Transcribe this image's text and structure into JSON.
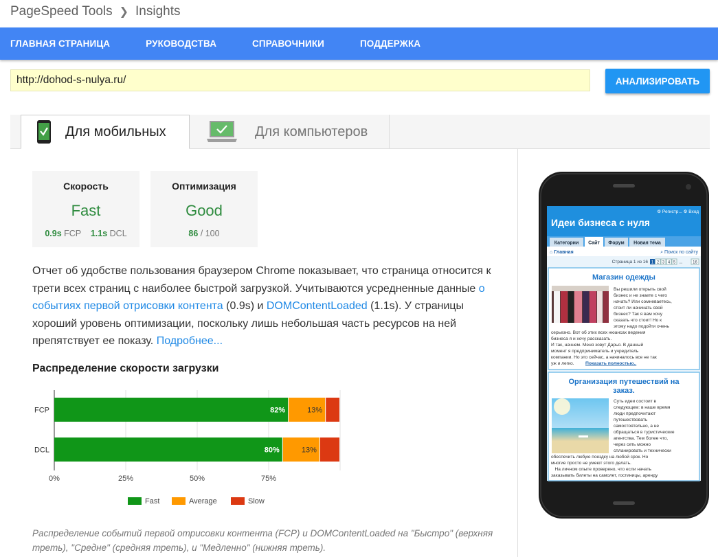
{
  "breadcrumb": {
    "root": "PageSpeed Tools",
    "current": "Insights"
  },
  "nav": {
    "items": [
      "ГЛАВНАЯ СТРАНИЦА",
      "РУКОВОДСТВА",
      "СПРАВОЧНИКИ",
      "ПОДДЕРЖКА"
    ]
  },
  "url_input": {
    "value": "http://dohod-s-nulya.ru/"
  },
  "analyze_button": "АНАЛИЗИРОВАТЬ",
  "tabs": [
    {
      "label": "Для мобильных",
      "icon": "mobile-check-icon",
      "active": true
    },
    {
      "label": "Для компьютеров",
      "icon": "desktop-check-icon",
      "active": false
    }
  ],
  "speed_card": {
    "title": "Скорость",
    "value": "Fast",
    "fcp_value": "0.9s",
    "fcp_label": "FCP",
    "dcl_value": "1.1s",
    "dcl_label": "DCL"
  },
  "optimization_card": {
    "title": "Оптимизация",
    "value": "Good",
    "score": "86",
    "max": "/ 100"
  },
  "report": {
    "text1": "Отчет об удобстве пользования браузером Chrome показывает, что страница относится к трети всех страниц с наиболее быстрой загрузкой. Учитываются усредненные данные ",
    "link1": "о событиях первой отрисовки контента",
    "text2": " (0.9s) и ",
    "link2": "DOMContentLoaded",
    "text3": " (1.1s). У страницы хороший уровень оптимизации, поскольку лишь небольшая часть ресурсов на ней препятствует ее показу. ",
    "link3": "Подробнее..."
  },
  "distribution_title": "Распределение скорости загрузки",
  "chart_data": {
    "type": "bar",
    "orientation": "horizontal",
    "stacked": true,
    "categories": [
      "FCP",
      "DCL"
    ],
    "series": [
      {
        "name": "Fast",
        "color": "#109618",
        "values": [
          82,
          80
        ]
      },
      {
        "name": "Average",
        "color": "#ff9900",
        "values": [
          13,
          13
        ]
      },
      {
        "name": "Slow",
        "color": "#dc3912",
        "values": [
          5,
          7
        ]
      }
    ],
    "data_labels": [
      [
        "82%",
        "13%",
        ""
      ],
      [
        "80%",
        "13%",
        ""
      ]
    ],
    "x_ticks": [
      "0%",
      "25%",
      "50%",
      "75%"
    ],
    "xlim": [
      0,
      100
    ],
    "grid": true,
    "legend_position": "bottom"
  },
  "footnote": "Распределение событий первой отрисовки контента (FCP) и DOMContentLoaded на \"Быстро\" (верхняя треть), \"Средне\" (средняя треть), и \"Медленно\" (нижняя треть).",
  "phone": {
    "top_links": [
      "Регистр...",
      "Вход"
    ],
    "site_title": "Идеи бизнеса с нуля",
    "tabs": [
      "Категории",
      "Сайт",
      "Форум",
      "Новая тема"
    ],
    "breadcrumb_home": "Главная",
    "search": "Поиск по сайту",
    "page_label": "Страница 1 из 16",
    "pages": [
      "1",
      "2",
      "3",
      "4",
      "5",
      "...",
      "16"
    ],
    "post1": {
      "title": "Магазин одежды",
      "text_right": [
        "Вы решили открыть свой",
        "бизнес и не знаете с чего",
        "начать? Или сомневаетесь,",
        "стоит ли начинать свой",
        "бизнес? Так я вам хочу",
        "сказать что стоит! Но к",
        "этому надо подойти очень"
      ],
      "text_full": [
        "серьезно. Вот об этих всех нюансах ведения",
        "бизнеса я и хочу рассказать.",
        "И так, начнем. Меня зовут Дарья. В данный",
        "момент я предприниматель и учредитель",
        "компании. Но это сейчас, а начиналось все не так"
      ],
      "last_line": "уж и легко.",
      "more": "Показать полностью.."
    },
    "post2": {
      "title": "Организация путешествий на заказ.",
      "text_right": [
        "Суть идеи состоит в",
        "следующем: в наше время",
        "люди предпочитают",
        "путешествовать",
        "самостоятельно, а не",
        "обращаться в туристические",
        "агентства. Тем более что,",
        "через сеть можно",
        "спланировать и технически"
      ],
      "text_full": [
        "обеспечить любую поездку на любой срок. Но",
        "многие просто не умеют этого делать.",
        "   На личном опыте проверено, что если начать",
        "заказывать билеты на самолет, гостиницы, аренду"
      ]
    }
  }
}
